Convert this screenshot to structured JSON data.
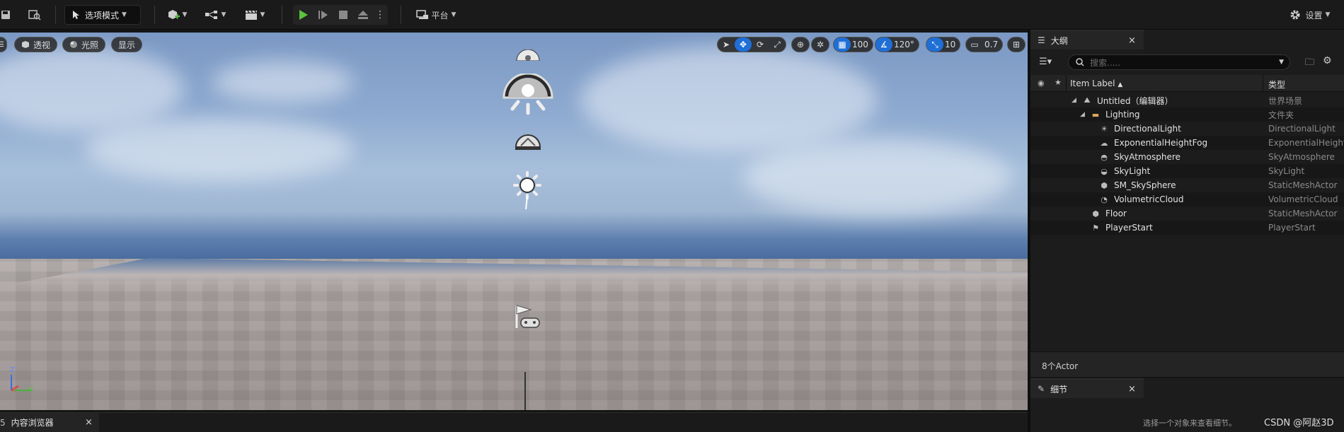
{
  "toolbar": {
    "mode_label": "选项模式",
    "platform_label": "平台",
    "settings_label": "设置"
  },
  "viewport": {
    "perspective_label": "透视",
    "lit_label": "光照",
    "show_label": "显示",
    "grid_snap_value": "100",
    "rotation_snap_value": "120°",
    "scale_snap_value": "10",
    "camera_speed_value": "0.7",
    "axis_z_label": "Z",
    "axis_x_label": "X",
    "axis_y_label": "Y"
  },
  "outliner": {
    "tab_title": "大纲",
    "search_placeholder": "搜索.....",
    "col_label": "Item Label",
    "col_type": "类型",
    "rows": [
      {
        "label": "Untitled（编辑器）",
        "type": "世界场景",
        "icon": "world-icon"
      },
      {
        "label": "Lighting",
        "type": "文件夹",
        "icon": "folder-icon"
      },
      {
        "label": "DirectionalLight",
        "type": "DirectionalLight",
        "icon": "directional-light-icon"
      },
      {
        "label": "ExponentialHeightFog",
        "type": "ExponentialHeight",
        "icon": "fog-icon"
      },
      {
        "label": "SkyAtmosphere",
        "type": "SkyAtmosphere",
        "icon": "sky-atmosphere-icon"
      },
      {
        "label": "SkyLight",
        "type": "SkyLight",
        "icon": "sky-light-icon"
      },
      {
        "label": "SM_SkySphere",
        "type": "StaticMeshActor",
        "icon": "static-mesh-icon"
      },
      {
        "label": "VolumetricCloud",
        "type": "VolumetricCloud",
        "icon": "cloud-icon"
      },
      {
        "label": "Floor",
        "type": "StaticMeshActor",
        "icon": "static-mesh-icon"
      },
      {
        "label": "PlayerStart",
        "type": "PlayerStart",
        "icon": "player-start-icon"
      }
    ],
    "actor_count": "8个Actor"
  },
  "details": {
    "tab_title": "细节",
    "hint": "选择一个对象来查看细节。",
    "watermark": "CSDN @阿赵3D"
  },
  "content_browser": {
    "tab_title": "内容浏览器",
    "tab_prefix": "5"
  }
}
